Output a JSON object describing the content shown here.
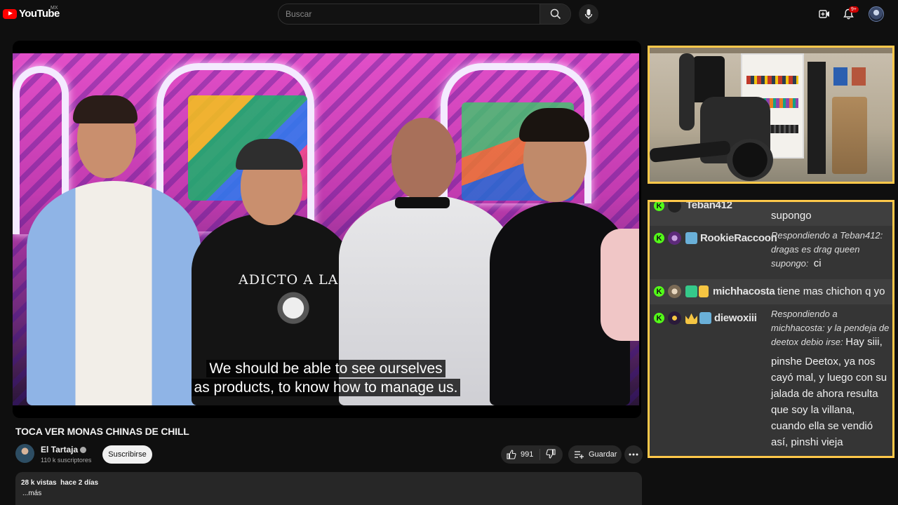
{
  "header": {
    "logo_text": "YouTube",
    "country": "MX",
    "search_placeholder": "Buscar",
    "notification_count": "9+"
  },
  "video": {
    "subtitle_line1": "We should be able to see ourselves",
    "subtitle_line2": "as products, to know how to manage us.",
    "shirt_text": "ADICTO A LAS",
    "title": "TOCA VER MONAS CHINAS DE CHILL"
  },
  "channel": {
    "name": "El Tartaja",
    "subscribers": "110 k suscriptores",
    "subscribe_label": "Suscribirse"
  },
  "actions": {
    "likes": "991",
    "save_label": "Guardar"
  },
  "description": {
    "views": "28 k vistas",
    "age": "hace 2 días",
    "more": "...más"
  },
  "colors": {
    "panel_border": "#ffc84a",
    "kick_green": "#53fc18",
    "brand_red": "#ff0000"
  },
  "chat": {
    "messages": [
      {
        "user": "Teban412",
        "text": "supongo"
      },
      {
        "user": "RookieRaccoon",
        "reply_line1": "Respondiendo a Teban412:",
        "reply_line2": "dragas es drag queen",
        "reply_line3": "supongo:",
        "text": "ci"
      },
      {
        "user": "michhacosta",
        "text": "tiene mas chichon q yo"
      },
      {
        "user": "diewoxiii",
        "reply_line1": "Respondiendo a",
        "reply_line2": "michhacosta: y la pendeja de",
        "reply_line3": "deetox debio irse:",
        "text_line1": "Hay siii,",
        "text_line2": "pinshe Deetox, ya nos",
        "text_line3": "cayó mal, y luego con su",
        "text_line4": "jalada de ahora resulta",
        "text_line5": "que soy la villana,",
        "text_line6": "cuando ella se vendió",
        "text_line7": "así, pinshi vieja"
      }
    ]
  }
}
